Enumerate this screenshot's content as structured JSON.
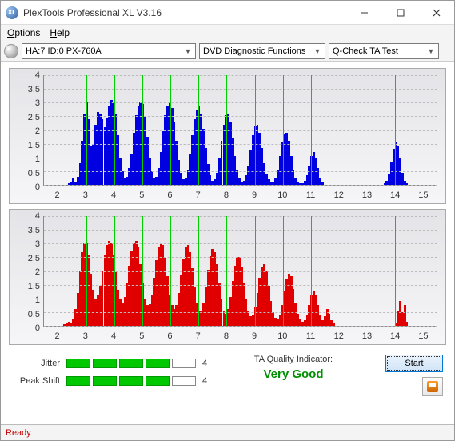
{
  "window": {
    "title": "PlexTools Professional XL V3.16",
    "icon_text": "XL"
  },
  "menu": {
    "options": "Options",
    "help": "Help"
  },
  "toolbar": {
    "device": "HA:7 ID:0   PX-760A",
    "category": "DVD Diagnostic Functions",
    "test": "Q-Check TA Test"
  },
  "chart_data": [
    {
      "type": "bar",
      "color": "#0000e0",
      "xlabel": "",
      "ylabel": "",
      "xlim": [
        1.5,
        15.5
      ],
      "ylim": [
        0,
        4
      ],
      "xticks": [
        2,
        3,
        4,
        5,
        6,
        7,
        8,
        9,
        10,
        11,
        12,
        13,
        14,
        15
      ],
      "yticks": [
        0,
        0.5,
        1,
        1.5,
        2,
        2.5,
        3,
        3.5,
        4
      ],
      "gridlines_x": [
        3,
        4,
        5,
        6,
        7,
        8,
        9,
        10,
        11,
        14
      ],
      "bins": [
        [
          2.38,
          0.05
        ],
        [
          2.46,
          0.1
        ],
        [
          2.54,
          0.25
        ],
        [
          2.62,
          0.1
        ],
        [
          2.7,
          0.3
        ],
        [
          2.78,
          0.8
        ],
        [
          2.86,
          1.6
        ],
        [
          2.94,
          2.6
        ],
        [
          3.02,
          3.05
        ],
        [
          3.1,
          2.4
        ],
        [
          3.18,
          1.4
        ],
        [
          3.26,
          1.5
        ],
        [
          3.34,
          2.2
        ],
        [
          3.42,
          2.65
        ],
        [
          3.5,
          2.6
        ],
        [
          3.58,
          2.4
        ],
        [
          3.66,
          2.1
        ],
        [
          3.74,
          2.45
        ],
        [
          3.82,
          2.85
        ],
        [
          3.9,
          3.1
        ],
        [
          3.98,
          3.0
        ],
        [
          4.06,
          2.6
        ],
        [
          4.14,
          1.8
        ],
        [
          4.22,
          1.0
        ],
        [
          4.3,
          0.5
        ],
        [
          4.38,
          0.25
        ],
        [
          4.46,
          0.3
        ],
        [
          4.54,
          0.6
        ],
        [
          4.62,
          1.1
        ],
        [
          4.7,
          1.9
        ],
        [
          4.78,
          2.55
        ],
        [
          4.86,
          2.9
        ],
        [
          4.94,
          3.05
        ],
        [
          5.02,
          2.95
        ],
        [
          5.1,
          2.5
        ],
        [
          5.18,
          1.75
        ],
        [
          5.26,
          1.0
        ],
        [
          5.34,
          0.5
        ],
        [
          5.42,
          0.25
        ],
        [
          5.5,
          0.3
        ],
        [
          5.58,
          0.6
        ],
        [
          5.66,
          1.2
        ],
        [
          5.74,
          1.95
        ],
        [
          5.82,
          2.55
        ],
        [
          5.9,
          2.9
        ],
        [
          5.98,
          3.0
        ],
        [
          6.06,
          2.8
        ],
        [
          6.14,
          2.3
        ],
        [
          6.22,
          1.6
        ],
        [
          6.3,
          0.9
        ],
        [
          6.38,
          0.45
        ],
        [
          6.46,
          0.2
        ],
        [
          6.54,
          0.25
        ],
        [
          6.62,
          0.55
        ],
        [
          6.7,
          1.1
        ],
        [
          6.78,
          1.8
        ],
        [
          6.86,
          2.4
        ],
        [
          6.94,
          2.75
        ],
        [
          7.02,
          2.85
        ],
        [
          7.1,
          2.6
        ],
        [
          7.18,
          2.05
        ],
        [
          7.26,
          1.35
        ],
        [
          7.34,
          0.75
        ],
        [
          7.42,
          0.35
        ],
        [
          7.5,
          0.15
        ],
        [
          7.58,
          0.2
        ],
        [
          7.66,
          0.45
        ],
        [
          7.74,
          0.95
        ],
        [
          7.82,
          1.6
        ],
        [
          7.9,
          2.2
        ],
        [
          7.98,
          2.55
        ],
        [
          8.06,
          2.6
        ],
        [
          8.14,
          2.3
        ],
        [
          8.22,
          1.7
        ],
        [
          8.3,
          1.05
        ],
        [
          8.38,
          0.55
        ],
        [
          8.46,
          0.25
        ],
        [
          8.54,
          0.1
        ],
        [
          8.62,
          0.15
        ],
        [
          8.7,
          0.35
        ],
        [
          8.78,
          0.7
        ],
        [
          8.86,
          1.25
        ],
        [
          8.94,
          1.8
        ],
        [
          9.02,
          2.15
        ],
        [
          9.1,
          2.2
        ],
        [
          9.18,
          1.9
        ],
        [
          9.26,
          1.35
        ],
        [
          9.34,
          0.8
        ],
        [
          9.42,
          0.4
        ],
        [
          9.5,
          0.2
        ],
        [
          9.58,
          0.08
        ],
        [
          9.66,
          0.1
        ],
        [
          9.74,
          0.25
        ],
        [
          9.82,
          0.55
        ],
        [
          9.9,
          1.05
        ],
        [
          9.98,
          1.55
        ],
        [
          10.06,
          1.85
        ],
        [
          10.14,
          1.9
        ],
        [
          10.22,
          1.6
        ],
        [
          10.3,
          1.05
        ],
        [
          10.38,
          0.55
        ],
        [
          10.46,
          0.25
        ],
        [
          10.54,
          0.1
        ],
        [
          10.62,
          0.05
        ],
        [
          10.7,
          0.05
        ],
        [
          10.78,
          0.15
        ],
        [
          10.86,
          0.35
        ],
        [
          10.94,
          0.7
        ],
        [
          11.02,
          1.05
        ],
        [
          11.1,
          1.2
        ],
        [
          11.18,
          1.0
        ],
        [
          11.26,
          0.6
        ],
        [
          11.34,
          0.25
        ],
        [
          11.42,
          0.1
        ],
        [
          13.62,
          0.05
        ],
        [
          13.7,
          0.15
        ],
        [
          13.78,
          0.4
        ],
        [
          13.86,
          0.85
        ],
        [
          13.94,
          1.3
        ],
        [
          14.02,
          1.55
        ],
        [
          14.1,
          1.4
        ],
        [
          14.18,
          0.95
        ],
        [
          14.26,
          0.45
        ],
        [
          14.34,
          0.15
        ],
        [
          14.42,
          0.05
        ]
      ]
    },
    {
      "type": "bar",
      "color": "#e00000",
      "xlabel": "",
      "ylabel": "",
      "xlim": [
        1.5,
        15.5
      ],
      "ylim": [
        0,
        4
      ],
      "xticks": [
        2,
        3,
        4,
        5,
        6,
        7,
        8,
        9,
        10,
        11,
        12,
        13,
        14,
        15
      ],
      "yticks": [
        0,
        0.5,
        1,
        1.5,
        2,
        2.5,
        3,
        3.5,
        4
      ],
      "gridlines_x": [
        3,
        4,
        5,
        6,
        7,
        8,
        9,
        10,
        11,
        14
      ],
      "bins": [
        [
          2.22,
          0.05
        ],
        [
          2.3,
          0.1
        ],
        [
          2.38,
          0.15
        ],
        [
          2.46,
          0.1
        ],
        [
          2.54,
          0.25
        ],
        [
          2.62,
          0.6
        ],
        [
          2.7,
          1.2
        ],
        [
          2.78,
          2.0
        ],
        [
          2.86,
          2.7
        ],
        [
          2.94,
          3.05
        ],
        [
          3.02,
          3.0
        ],
        [
          3.1,
          2.6
        ],
        [
          3.18,
          1.9
        ],
        [
          3.26,
          1.3
        ],
        [
          3.34,
          1.0
        ],
        [
          3.42,
          1.1
        ],
        [
          3.5,
          1.45
        ],
        [
          3.58,
          2.0
        ],
        [
          3.66,
          2.6
        ],
        [
          3.74,
          2.95
        ],
        [
          3.82,
          3.1
        ],
        [
          3.9,
          3.0
        ],
        [
          3.98,
          2.6
        ],
        [
          4.06,
          1.95
        ],
        [
          4.14,
          1.3
        ],
        [
          4.22,
          0.95
        ],
        [
          4.3,
          0.85
        ],
        [
          4.38,
          1.05
        ],
        [
          4.46,
          1.55
        ],
        [
          4.54,
          2.2
        ],
        [
          4.62,
          2.75
        ],
        [
          4.7,
          3.05
        ],
        [
          4.78,
          3.1
        ],
        [
          4.86,
          2.85
        ],
        [
          4.94,
          2.25
        ],
        [
          5.02,
          1.55
        ],
        [
          5.1,
          1.0
        ],
        [
          5.18,
          0.75
        ],
        [
          5.26,
          0.8
        ],
        [
          5.34,
          1.15
        ],
        [
          5.42,
          1.75
        ],
        [
          5.5,
          2.4
        ],
        [
          5.58,
          2.85
        ],
        [
          5.66,
          3.05
        ],
        [
          5.74,
          2.95
        ],
        [
          5.82,
          2.5
        ],
        [
          5.9,
          1.8
        ],
        [
          5.98,
          1.15
        ],
        [
          6.06,
          0.75
        ],
        [
          6.14,
          0.6
        ],
        [
          6.22,
          0.75
        ],
        [
          6.3,
          1.2
        ],
        [
          6.38,
          1.85
        ],
        [
          6.46,
          2.45
        ],
        [
          6.54,
          2.85
        ],
        [
          6.62,
          2.95
        ],
        [
          6.7,
          2.7
        ],
        [
          6.78,
          2.1
        ],
        [
          6.86,
          1.4
        ],
        [
          6.94,
          0.85
        ],
        [
          7.02,
          0.55
        ],
        [
          7.1,
          0.55
        ],
        [
          7.18,
          0.85
        ],
        [
          7.26,
          1.4
        ],
        [
          7.34,
          2.05
        ],
        [
          7.42,
          2.55
        ],
        [
          7.5,
          2.8
        ],
        [
          7.58,
          2.7
        ],
        [
          7.66,
          2.25
        ],
        [
          7.74,
          1.55
        ],
        [
          7.82,
          0.95
        ],
        [
          7.9,
          0.55
        ],
        [
          7.98,
          0.45
        ],
        [
          8.06,
          0.6
        ],
        [
          8.14,
          1.05
        ],
        [
          8.22,
          1.65
        ],
        [
          8.3,
          2.2
        ],
        [
          8.38,
          2.5
        ],
        [
          8.46,
          2.5
        ],
        [
          8.54,
          2.15
        ],
        [
          8.62,
          1.55
        ],
        [
          8.7,
          0.95
        ],
        [
          8.78,
          0.55
        ],
        [
          8.86,
          0.35
        ],
        [
          8.94,
          0.4
        ],
        [
          9.02,
          0.7
        ],
        [
          9.1,
          1.2
        ],
        [
          9.18,
          1.75
        ],
        [
          9.26,
          2.15
        ],
        [
          9.34,
          2.25
        ],
        [
          9.42,
          2.0
        ],
        [
          9.5,
          1.45
        ],
        [
          9.58,
          0.9
        ],
        [
          9.66,
          0.5
        ],
        [
          9.74,
          0.3
        ],
        [
          9.82,
          0.25
        ],
        [
          9.9,
          0.4
        ],
        [
          9.98,
          0.75
        ],
        [
          10.06,
          1.25
        ],
        [
          10.14,
          1.7
        ],
        [
          10.22,
          1.9
        ],
        [
          10.3,
          1.8
        ],
        [
          10.38,
          1.35
        ],
        [
          10.46,
          0.85
        ],
        [
          10.54,
          0.45
        ],
        [
          10.62,
          0.25
        ],
        [
          10.7,
          0.15
        ],
        [
          10.78,
          0.2
        ],
        [
          10.86,
          0.4
        ],
        [
          10.94,
          0.75
        ],
        [
          11.02,
          1.1
        ],
        [
          11.1,
          1.25
        ],
        [
          11.18,
          1.1
        ],
        [
          11.26,
          0.75
        ],
        [
          11.34,
          0.4
        ],
        [
          11.42,
          0.2
        ],
        [
          11.5,
          0.35
        ],
        [
          11.58,
          0.6
        ],
        [
          11.66,
          0.45
        ],
        [
          11.74,
          0.2
        ],
        [
          11.82,
          0.08
        ],
        [
          14.02,
          0.1
        ],
        [
          14.1,
          0.55
        ],
        [
          14.18,
          0.9
        ],
        [
          14.26,
          0.5
        ],
        [
          14.34,
          0.75
        ],
        [
          14.42,
          0.15
        ]
      ]
    }
  ],
  "metrics": {
    "jitter_label": "Jitter",
    "jitter_value": "4",
    "jitter_score": 4,
    "peakshift_label": "Peak Shift",
    "peakshift_value": "4",
    "peakshift_score": 4
  },
  "quality": {
    "label": "TA Quality Indicator:",
    "value": "Very Good"
  },
  "actions": {
    "start": "Start"
  },
  "status": "Ready"
}
